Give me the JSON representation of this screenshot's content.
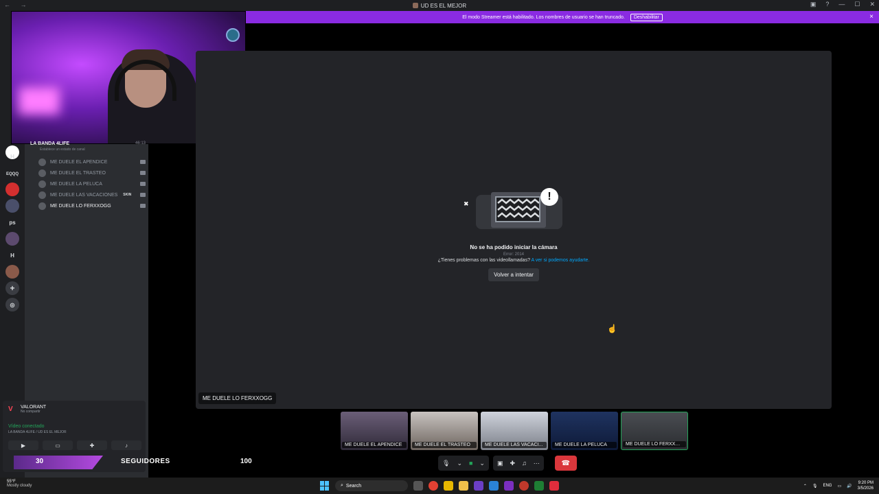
{
  "window": {
    "title": "UD ES EL MEJOR",
    "nav": "← →"
  },
  "banner": {
    "text": "El modo Streamer está habilitado. Los nombres de usuario se han truncado.",
    "button": "Deshabilitar",
    "close": "×"
  },
  "guilds": [
    "H",
    "EQQQ",
    "ps",
    "H"
  ],
  "voice_channel": {
    "name": "LA BANDA 4LIFE",
    "time": "46:13",
    "status": "Establece un estado de canal"
  },
  "members": [
    {
      "name": "ME DUELE EL APENDICE"
    },
    {
      "name": "ME DUELE EL TRASTEO"
    },
    {
      "name": "ME DUELE LA PELUCA"
    },
    {
      "name": "ME DUELE LAS VACACIONES",
      "badge": "SKIN"
    },
    {
      "name": "ME DUELE LO FERXXOGG"
    }
  ],
  "activity": {
    "game": "VALORANT",
    "sub": "No compartir"
  },
  "connection": {
    "status": "Vídeo conectado",
    "location": "LA BANDA 4LIFE / UD ES EL MEJOR"
  },
  "overlay": {
    "followers": "30",
    "label": "SEGUIDORES",
    "goal": "100"
  },
  "error": {
    "title": "No se ha podido iniciar la cámara",
    "code": "Error: 2014",
    "question": "¿Tienes problemas con las videollamadas?",
    "link": "A ver si podemos ayudarte.",
    "retry": "Volver a intentar"
  },
  "stage_label": "ME DUELE LO FERXXOGG",
  "tiles": [
    {
      "name": "ME DUELE EL APENDICE"
    },
    {
      "name": "ME DUELE EL TRASTEO"
    },
    {
      "name": "ME DUELE LAS VACACI..."
    },
    {
      "name": "ME DUELE LA PELUCA"
    },
    {
      "name": "ME DUELE LO FERXXOGG"
    }
  ],
  "taskbar": {
    "weather_temp": "55°F",
    "weather_desc": "Mostly cloudy",
    "search": "Search",
    "lang": "ENG",
    "time": "9:20 PM",
    "date": "3/5/2026"
  },
  "colors": {
    "accent": "#8a2be2",
    "green": "#23a55a",
    "red": "#da373c",
    "link": "#00a8fc"
  }
}
